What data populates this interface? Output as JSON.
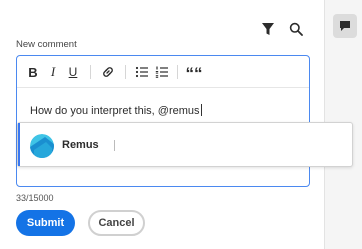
{
  "toolbar": {
    "filter_icon": "filter-icon",
    "search_icon": "search-icon"
  },
  "rail": {
    "comments_icon": "comment-icon"
  },
  "composer": {
    "label": "New comment",
    "text": "How do you interpret this, @remus",
    "char_count": "33/15000",
    "formatting": {
      "bold": "B",
      "italic": "I",
      "underline": "U",
      "link_icon": "link-icon",
      "bullets_icon": "bulleted-list-icon",
      "numbers_icon": "numbered-list-icon",
      "quote": "““"
    }
  },
  "mention": {
    "suggestions": [
      {
        "name": "Remus",
        "avatar_icon": "avatar-icon"
      }
    ]
  },
  "actions": {
    "submit": "Submit",
    "cancel": "Cancel"
  },
  "colors": {
    "accent": "#1473e6",
    "focus_border": "#4b89f0",
    "avatar_light": "#3fc4e6",
    "avatar_dark": "#1a8fd0"
  }
}
